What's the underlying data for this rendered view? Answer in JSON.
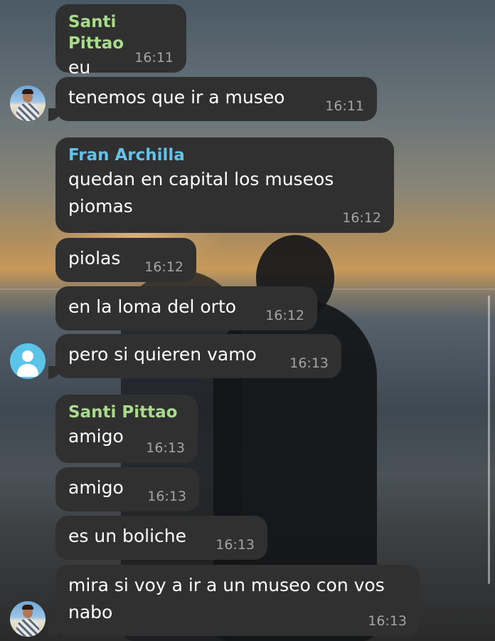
{
  "messages": [
    {
      "sender": "Santi Pittao",
      "text": "eu",
      "time": "16:11"
    },
    {
      "text": "tenemos que ir a museo",
      "time": "16:11"
    },
    {
      "sender": "Fran Archilla",
      "text_lines": [
        "quedan en capital los museos",
        "piomas"
      ],
      "time": "16:12"
    },
    {
      "text": "piolas",
      "time": "16:12"
    },
    {
      "text": "en la loma del orto",
      "time": "16:12"
    },
    {
      "text": "pero si quieren vamo",
      "time": "16:13"
    },
    {
      "sender": "Santi Pittao",
      "text": "amigo",
      "time": "16:13"
    },
    {
      "text": "amigo",
      "time": "16:13"
    },
    {
      "text": "es un boliche",
      "time": "16:13"
    },
    {
      "text_lines": [
        "mira si voy a ir a un museo con vos",
        "nabo"
      ],
      "time": "16:13"
    }
  ],
  "colors": {
    "bubble": "#303031",
    "sender_santi": "#a9dc8a",
    "sender_fran": "#63c1ea",
    "time": "#a4a4a6",
    "default_avatar": "#5bc4e8"
  }
}
